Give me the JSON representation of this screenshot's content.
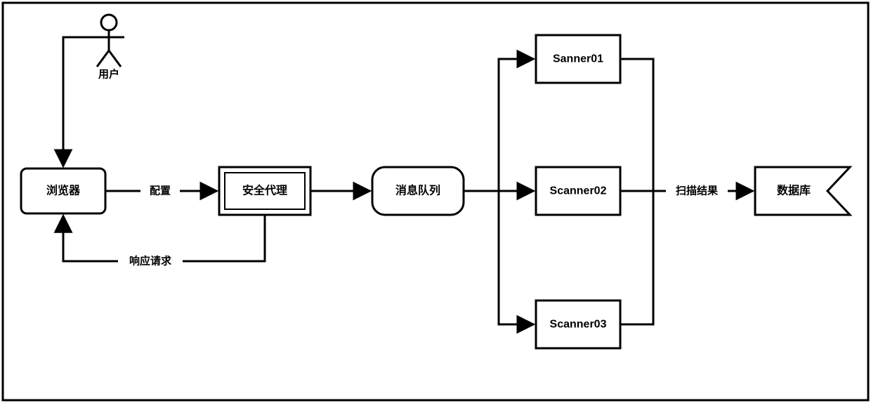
{
  "actor": {
    "label": "用户"
  },
  "nodes": {
    "browser": {
      "label": "浏览器"
    },
    "proxy": {
      "label": "安全代理"
    },
    "queue": {
      "label": "消息队列"
    },
    "scanner1": {
      "label": "Sanner01"
    },
    "scanner2": {
      "label": "Scanner02"
    },
    "scanner3": {
      "label": "Scanner03"
    },
    "database": {
      "label": "数据库"
    }
  },
  "edges": {
    "config": {
      "label": "配置"
    },
    "response": {
      "label": "响应请求"
    },
    "scan_result": {
      "label": "扫描结果"
    }
  }
}
